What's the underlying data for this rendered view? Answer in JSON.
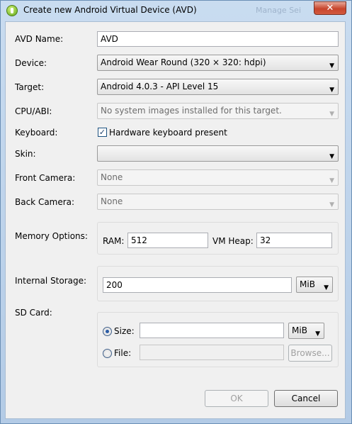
{
  "window": {
    "title": "Create new Android Virtual Device (AVD)",
    "background_hint": "Manage Sei",
    "close_glyph": "✕"
  },
  "form": {
    "avd_name": {
      "label": "AVD Name:",
      "value": "AVD"
    },
    "device": {
      "label": "Device:",
      "value": "Android Wear Round (320 × 320: hdpi)"
    },
    "target": {
      "label": "Target:",
      "value": "Android 4.0.3 - API Level 15"
    },
    "cpu_abi": {
      "label": "CPU/ABI:",
      "value": "No system images installed for this target."
    },
    "keyboard": {
      "label": "Keyboard:",
      "checkbox_label": "Hardware keyboard present",
      "checked": true,
      "check_glyph": "✓"
    },
    "skin": {
      "label": "Skin:",
      "value": ""
    },
    "front_camera": {
      "label": "Front Camera:",
      "value": "None"
    },
    "back_camera": {
      "label": "Back Camera:",
      "value": "None"
    },
    "memory": {
      "label": "Memory Options:",
      "ram_label": "RAM:",
      "ram_value": "512",
      "vm_heap_label": "VM Heap:",
      "vm_heap_value": "32"
    },
    "internal_storage": {
      "label": "Internal Storage:",
      "value": "200",
      "unit": "MiB"
    },
    "sd_card": {
      "label": "SD Card:",
      "size_label": "Size:",
      "size_value": "",
      "size_unit": "MiB",
      "file_label": "File:",
      "browse_label": "Browse...",
      "selected": "size"
    }
  },
  "buttons": {
    "ok": "OK",
    "cancel": "Cancel"
  },
  "icons": {
    "dropdown_arrow": "▼"
  }
}
